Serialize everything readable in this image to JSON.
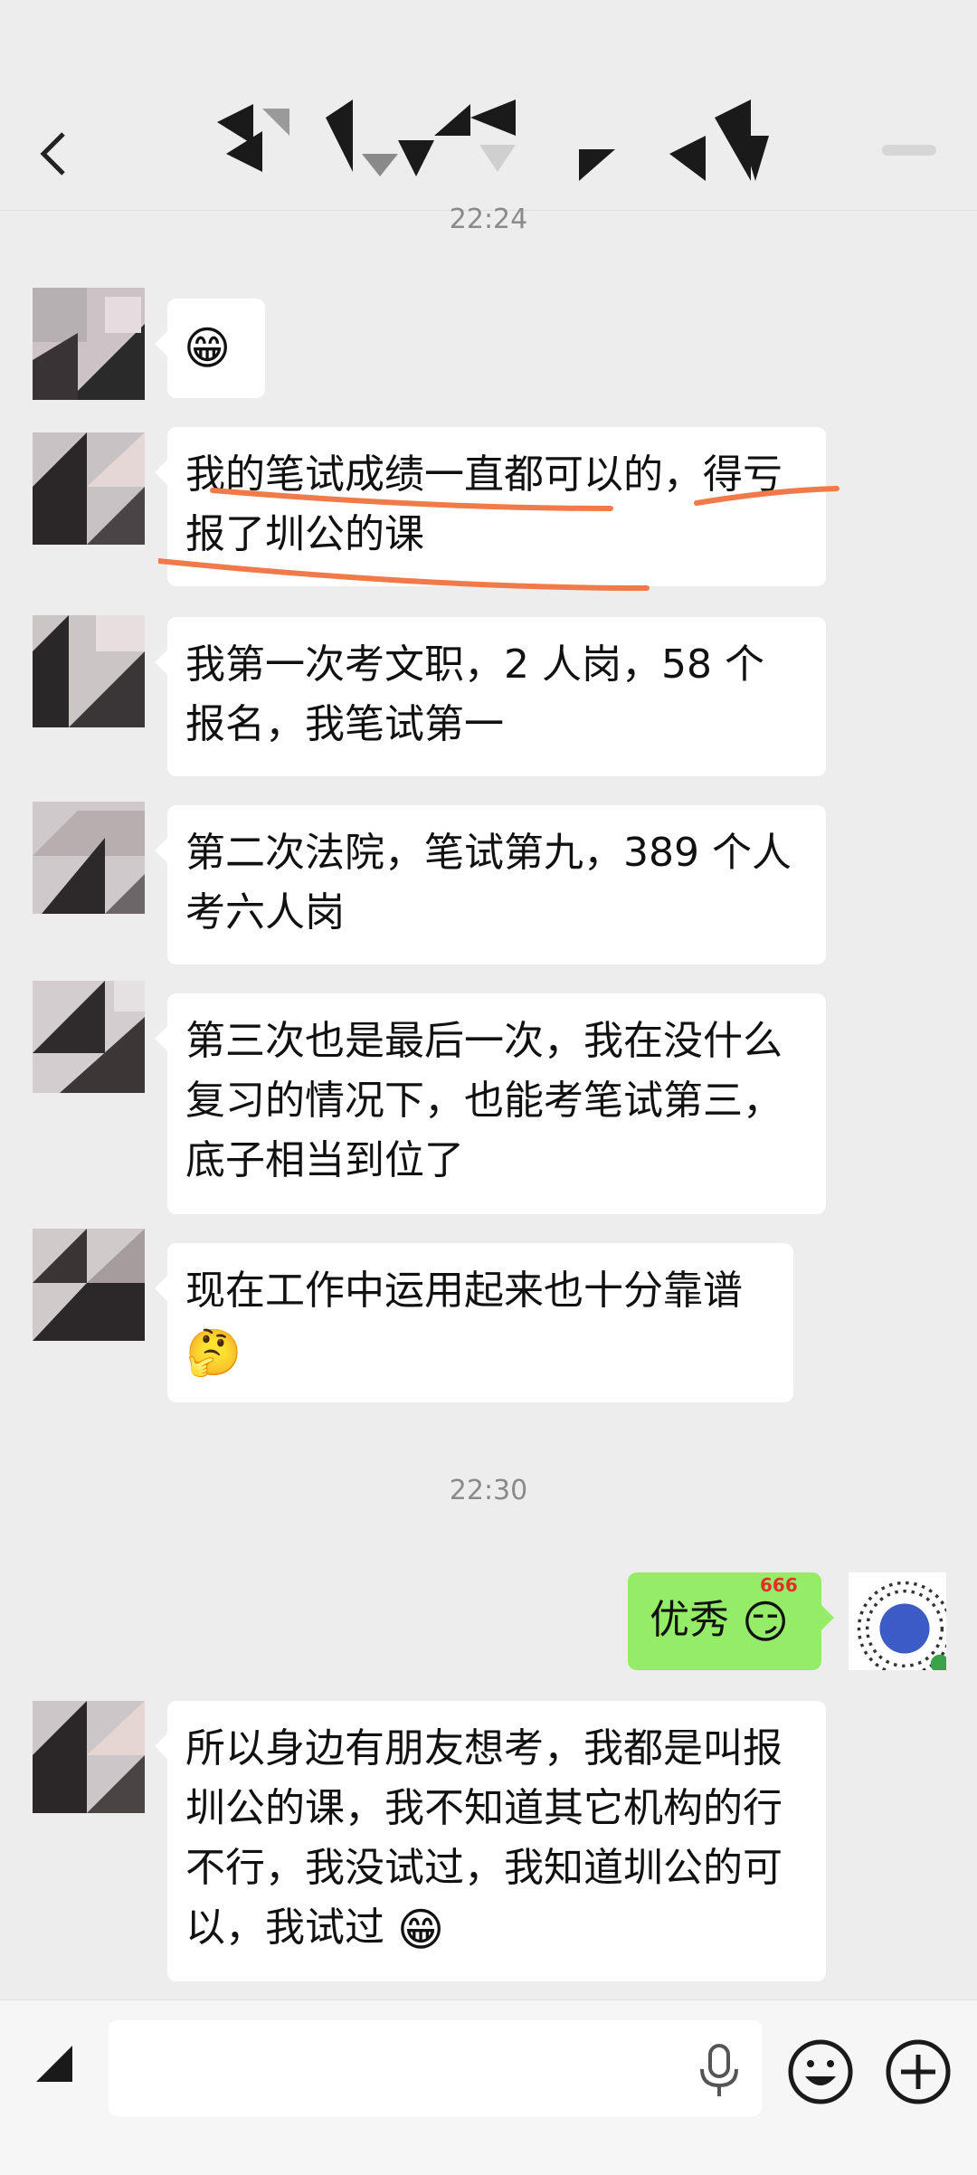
{
  "timestamps": [
    "22:24",
    "22:30"
  ],
  "messages": {
    "m1_emoji": "😁",
    "m2": "我的笔试成绩一直都可以的，得亏报了圳公的课",
    "m3": "我第一次考文职，2 人岗，58 个报名，我笔试第一",
    "m4": "第二次法院，笔试第九，389 个人考六人岗",
    "m5": "第三次也是最后一次，我在没什么复习的情况下，也能考笔试第三，底子相当到位了",
    "m6_text": "现在工作中运用起来也十分靠谱",
    "m6_emoji": "🤔",
    "mine": "优秀",
    "mine_emoji": "😏",
    "mine_badge": "666",
    "m7_text": "所以身边有朋友想考，我都是叫报圳公的课，我不知道其它机构的行不行，我没试过，我知道圳公的可以，我试过",
    "m7_emoji": "😁"
  },
  "icons": {
    "back": "chevron-left-icon",
    "more": "more-icon",
    "voice": "voice-toggle-icon",
    "mic": "microphone-icon",
    "emoji": "emoji-icon",
    "plus": "plus-icon"
  },
  "colors": {
    "background": "#ededed",
    "mine_bubble": "#95ec69",
    "underline": "#f07a4a"
  }
}
